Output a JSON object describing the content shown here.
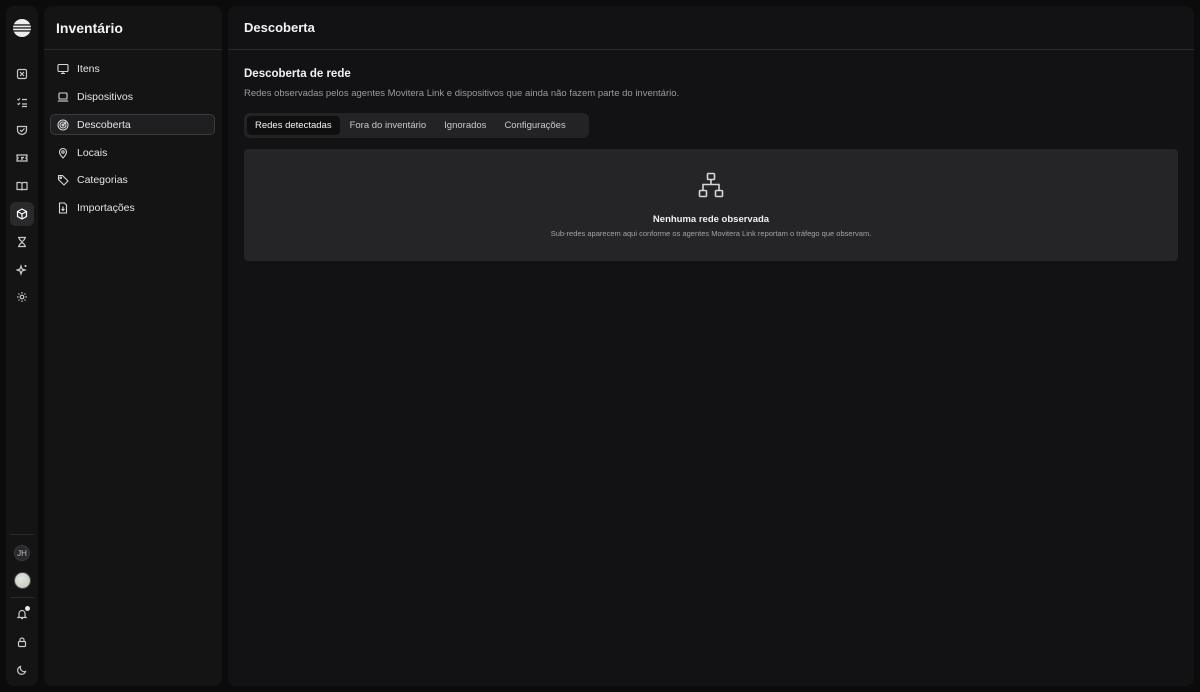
{
  "rail": {
    "items": [
      {
        "name": "rail-icon-close-box"
      },
      {
        "name": "rail-icon-checklist"
      },
      {
        "name": "rail-icon-shield"
      },
      {
        "name": "rail-icon-ticket"
      },
      {
        "name": "rail-icon-book"
      },
      {
        "name": "rail-icon-box",
        "active": true
      },
      {
        "name": "rail-icon-hourglass"
      },
      {
        "name": "rail-icon-sparkle"
      },
      {
        "name": "rail-icon-gear"
      }
    ],
    "user_initials": "JH"
  },
  "sidebar": {
    "title": "Inventário",
    "items": [
      {
        "label": "Itens",
        "icon": "monitor-icon"
      },
      {
        "label": "Dispositivos",
        "icon": "laptop-icon"
      },
      {
        "label": "Descoberta",
        "icon": "radar-icon",
        "active": true
      },
      {
        "label": "Locais",
        "icon": "map-pin-icon"
      },
      {
        "label": "Categorias",
        "icon": "tag-icon"
      },
      {
        "label": "Importações",
        "icon": "file-import-icon"
      }
    ]
  },
  "main": {
    "page_title": "Descoberta",
    "section_title": "Descoberta de rede",
    "section_description": "Redes observadas pelos agentes Movitera Link e dispositivos que ainda não fazem parte do inventário.",
    "tabs": [
      {
        "label": "Redes detectadas",
        "active": true
      },
      {
        "label": "Fora do inventário"
      },
      {
        "label": "Ignorados"
      },
      {
        "label": "Configurações"
      }
    ],
    "empty_state": {
      "icon": "network-icon",
      "title": "Nenhuma rede observada",
      "subtitle": "Sub-redes aparecem aqui conforme os agentes Movitera Link reportam o tráfego que observam."
    }
  }
}
